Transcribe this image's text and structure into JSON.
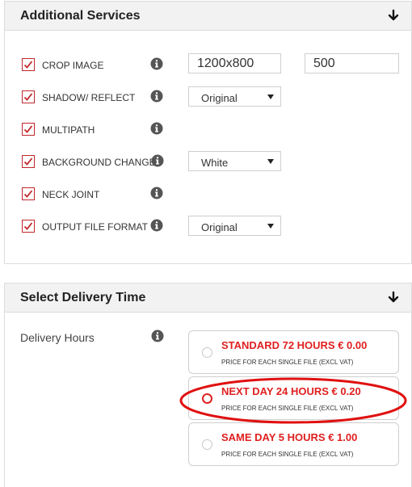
{
  "additional_services": {
    "title": "Additional Services",
    "rows": [
      {
        "label": "CROP IMAGE",
        "checked": true,
        "input1_value": "1200x800",
        "input2_value": "500"
      },
      {
        "label": "SHADOW/ REFLECT",
        "checked": true,
        "select_value": "Original"
      },
      {
        "label": "MULTIPATH",
        "checked": true
      },
      {
        "label": "BACKGROUND CHANGE",
        "checked": true,
        "select_value": "White"
      },
      {
        "label": "NECK JOINT",
        "checked": true
      },
      {
        "label": "OUTPUT FILE FORMAT",
        "checked": true,
        "select_value": "Original"
      }
    ]
  },
  "delivery": {
    "title": "Select Delivery Time",
    "label": "Delivery Hours",
    "options": [
      {
        "title": "STANDARD 72 HOURS € 0.00",
        "subtitle": "PRICE FOR EACH SINGLE FILE (EXCL VAT)",
        "selected": false
      },
      {
        "title": "NEXT DAY 24 HOURS € 0.20",
        "subtitle": "PRICE FOR EACH SINGLE FILE (EXCL VAT)",
        "selected": true
      },
      {
        "title": "SAME DAY 5 HOURS € 1.00",
        "subtitle": "PRICE FOR EACH SINGLE FILE (EXCL VAT)",
        "selected": false
      }
    ],
    "annotation": "red-ellipse-around-next-day-option"
  },
  "colors": {
    "accent_red": "#e02020",
    "checkbox_red": "#c1272d",
    "header_bg": "#f2f2f2",
    "border": "#dcdcdc"
  },
  "icons": [
    "arrow-down-icon",
    "info-icon",
    "checkmark-icon",
    "select-caret-icon"
  ]
}
